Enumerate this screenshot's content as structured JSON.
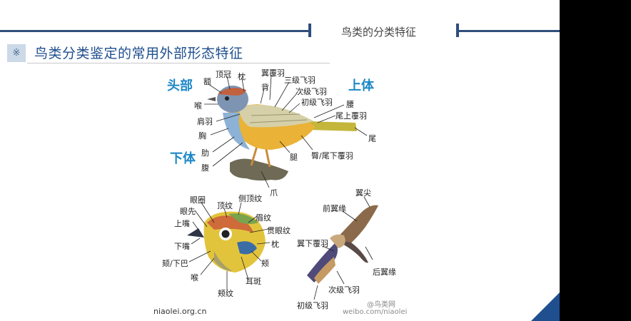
{
  "header": {
    "title": "鸟类的分类特征"
  },
  "section": {
    "marker": "※",
    "title": "鸟类分类鉴定的常用外部形态特征"
  },
  "regions": {
    "head": "头部",
    "upper": "上体",
    "lower": "下体"
  },
  "body_labels": {
    "e": "额",
    "dg": "顶冠",
    "zhen": "枕",
    "yfy": "翼覆羽",
    "bei": "背",
    "sjfy": "三级飞羽",
    "cjfy": "次级飞羽",
    "cjfy1": "初级飞羽",
    "yao": "腰",
    "wsfy": "尾上覆羽",
    "wei": "尾",
    "hou": "喉",
    "jianyu": "肩羽",
    "xiong": "胸",
    "lei": "肋",
    "fu": "腹",
    "tui": "腿",
    "tunwei": "臀/尾下覆羽",
    "zhua": "爪"
  },
  "head_labels": {
    "yq": "眼圈",
    "yx": "眼先",
    "ss": "上嘴",
    "xs": "下嘴",
    "kx": "颏/下巴",
    "hou": "喉",
    "dw": "顶纹",
    "cdw": "侧顶纹",
    "mw": "眉纹",
    "gyw": "贯眼纹",
    "zhen": "枕",
    "jia": "颊",
    "eb": "耳斑",
    "jiaw": "颊纹"
  },
  "wing_labels": {
    "yj": "翼尖",
    "qyy": "前翼缘",
    "yxfy": "翼下覆羽",
    "hyy": "后翼缘",
    "cjfy": "次级飞羽",
    "cjfy1": "初级飞羽"
  },
  "footer": {
    "site": "niaolei.org.cn",
    "weibo_name": "@鸟类网",
    "weibo_url": "weibo.com/niaolei"
  },
  "colors": {
    "accent": "#1f4f8e",
    "region": "#1d88c7"
  }
}
